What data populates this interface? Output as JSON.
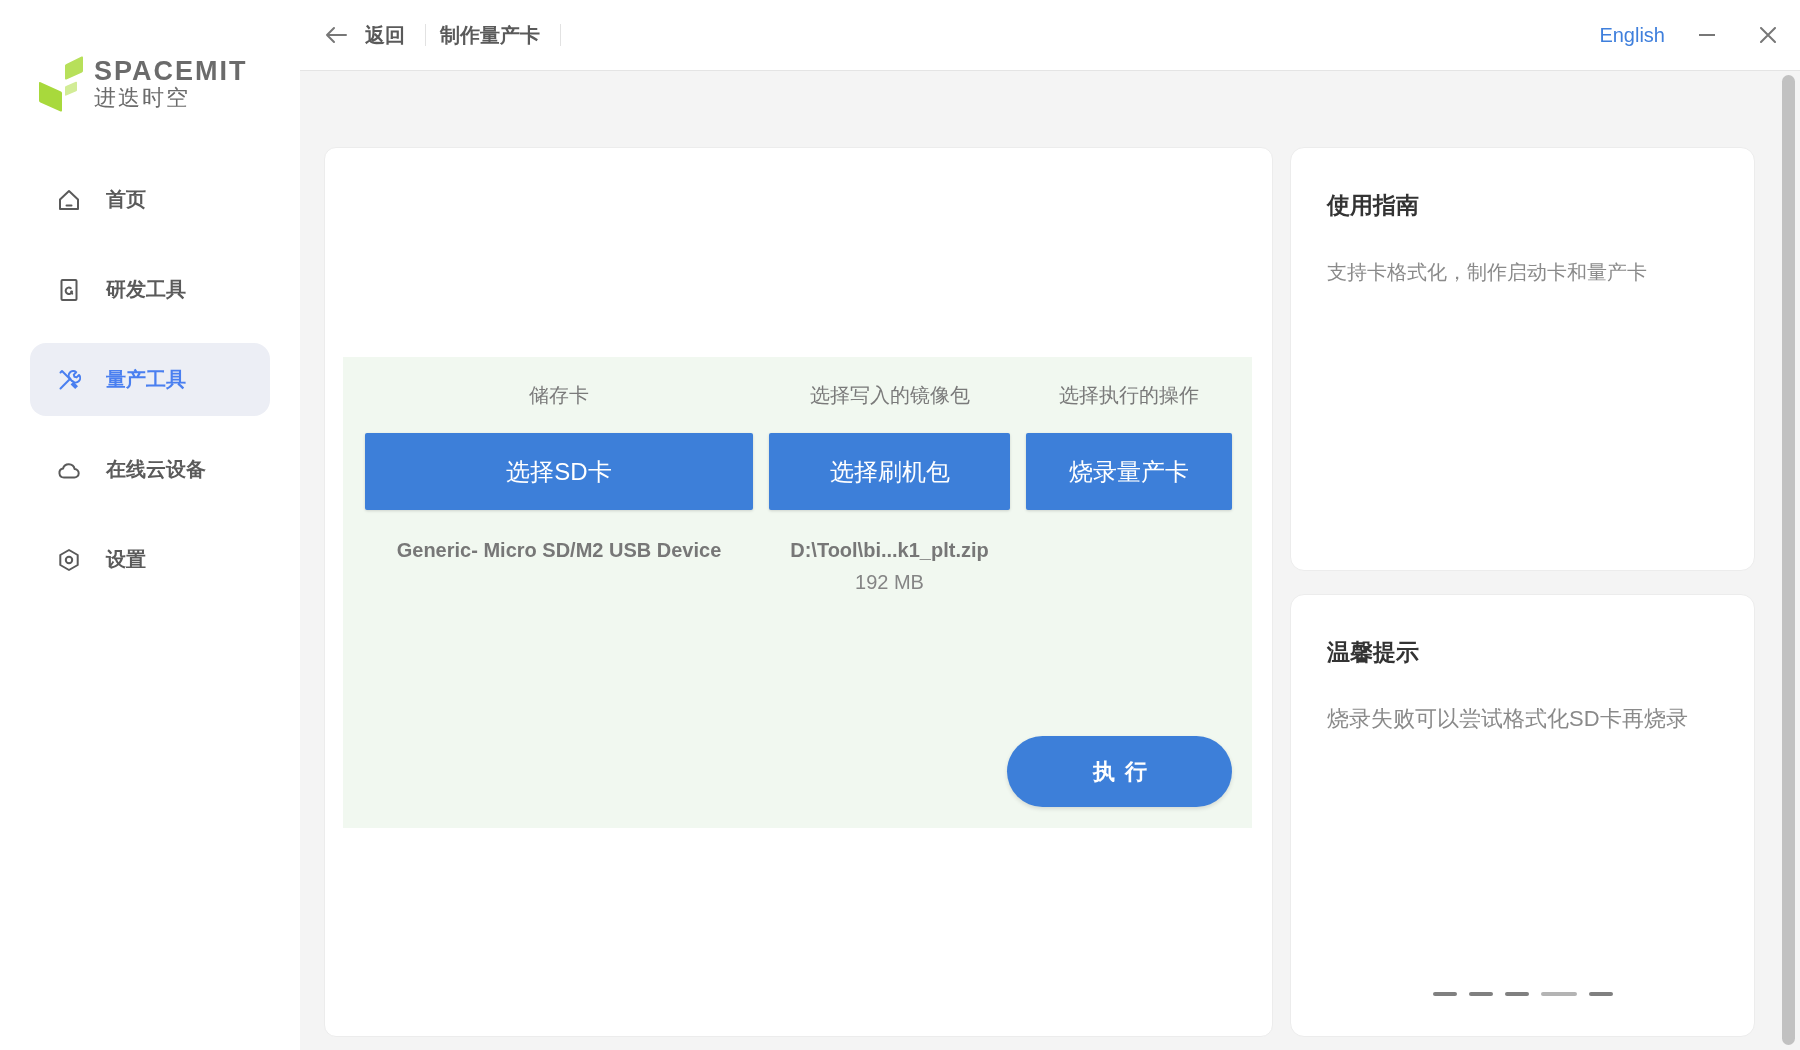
{
  "sidebar": {
    "logo": {
      "wordmark": "SPACEMIT",
      "tagline": "进迭时空"
    },
    "items": [
      {
        "label": "首页",
        "selected": false
      },
      {
        "label": "研发工具",
        "selected": false
      },
      {
        "label": "量产工具",
        "selected": true
      },
      {
        "label": "在线云设备",
        "selected": false
      },
      {
        "label": "设置",
        "selected": false
      }
    ]
  },
  "top_bar": {
    "back": "返回",
    "title": "制作量产卡",
    "language": "English"
  },
  "burn_panel": {
    "steps": [
      {
        "heading": "储存卡",
        "button": "选择SD卡",
        "detail": "Generic- Micro SD/M2 USB Device"
      },
      {
        "heading": "选择写入的镜像包",
        "button": "选择刷机包",
        "detail": "D:\\Tool\\bi...k1_plt.zip",
        "size": "192 MB"
      },
      {
        "heading": "选择执行的操作",
        "button": "烧录量产卡"
      }
    ],
    "execute": "执行"
  },
  "guide": {
    "title": "使用指南",
    "text": "支持卡格式化，制作启动卡和量产卡"
  },
  "tips": {
    "title": "温馨提示",
    "text": "烧录失败可以尝试格式化SD卡再烧录",
    "pages": [
      {
        "selected": false
      },
      {
        "selected": false
      },
      {
        "selected": false
      },
      {
        "selected": true
      },
      {
        "selected": false
      }
    ]
  }
}
